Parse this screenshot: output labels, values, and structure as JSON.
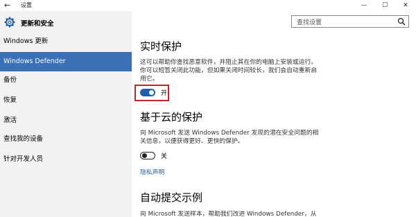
{
  "window": {
    "back_glyph": "←",
    "title": "设置",
    "minimize_glyph": "—",
    "maximize_glyph": "☐",
    "close_glyph": "✕"
  },
  "sidebar": {
    "section_title": "更新和安全",
    "items": [
      {
        "label": "Windows 更新",
        "selected": false
      },
      {
        "label": "Windows Defender",
        "selected": true
      },
      {
        "label": "备份",
        "selected": false
      },
      {
        "label": "恢复",
        "selected": false
      },
      {
        "label": "激活",
        "selected": false
      },
      {
        "label": "查找我的设备",
        "selected": false
      },
      {
        "label": "针对开发人员",
        "selected": false
      }
    ]
  },
  "search": {
    "placeholder": "查找设置"
  },
  "content": {
    "realtime": {
      "heading": "实时保护",
      "description": "这可以帮助你查找恶意软件，并阻止其在你的电脑上安装或运行。你可以短暂关闭此功能，但如果关闭时间较长，我们会自动重新启用它。",
      "toggle_state": "on",
      "toggle_label": "开"
    },
    "cloud": {
      "heading": "基于云的保护",
      "description": "向 Microsoft 发送 Windows Defender 发现的潜在安全问题的相关信息，以便获得更好、更快的保护。",
      "toggle_state": "off",
      "toggle_label": "关",
      "privacy_link": "隐私声明"
    },
    "sample": {
      "heading": "自动提交示例",
      "description": "向 Microsoft 发送样本，帮助我们改进 Windows Defender，从"
    }
  },
  "colors": {
    "selected_bg": "#3c70b6",
    "toggle_on": "#1f5fb3",
    "highlight": "#c0272d",
    "link": "#1f5fb3"
  }
}
